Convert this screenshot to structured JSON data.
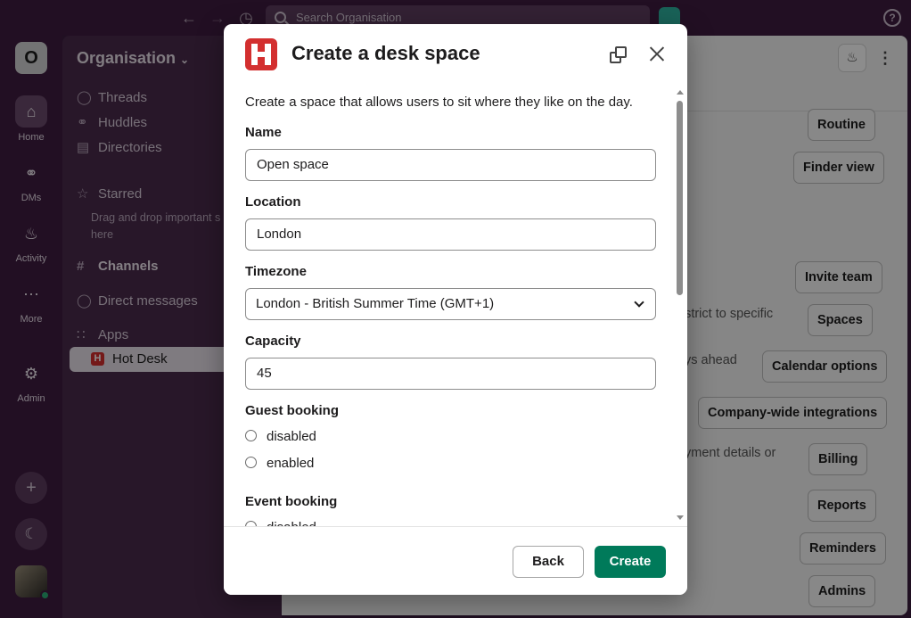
{
  "topbar": {
    "search_placeholder": "Search Organisation",
    "back_icon": "arrow-left-icon",
    "forward_icon": "arrow-right-icon",
    "history_icon": "clock-icon",
    "help_label": "?"
  },
  "rail": {
    "workspace_initial": "O",
    "items": [
      {
        "label": "Home",
        "icon": "home-icon"
      },
      {
        "label": "DMs",
        "icon": "dm-bubbles-icon"
      },
      {
        "label": "Activity",
        "icon": "bell-icon"
      },
      {
        "label": "More",
        "icon": "more-dots-icon"
      },
      {
        "label": "Admin",
        "icon": "gear-icon"
      }
    ],
    "add_label": "+",
    "theme_icon": "moon-icon"
  },
  "sidebar": {
    "org_name": "Organisation",
    "items": [
      {
        "label": "Threads",
        "icon": "threads-icon"
      },
      {
        "label": "Huddles",
        "icon": "headphones-icon"
      },
      {
        "label": "Directories",
        "icon": "directory-icon"
      },
      {
        "label": "Starred",
        "icon": "star-icon"
      },
      {
        "label": "Channels",
        "icon": "channel-icon"
      },
      {
        "label": "Direct messages",
        "icon": "dm-icon"
      },
      {
        "label": "Apps",
        "icon": "apps-grid-icon"
      }
    ],
    "starred_note": "Drag and drop important s here",
    "selected_app": "Hot Desk"
  },
  "main": {
    "buttons": [
      "Routine",
      "Finder view",
      "Invite team",
      "Spaces",
      "Calendar options",
      "Company-wide integrations",
      "Billing",
      "Reports",
      "Reminders",
      "Admins"
    ],
    "texts": [
      ".",
      "estrict to specific",
      "ys ahead",
      "yment details or"
    ]
  },
  "modal": {
    "title": "Create a desk space",
    "description": "Create a space that allows users to sit where they like on the day.",
    "fields": {
      "name_label": "Name",
      "name_value": "Open space",
      "location_label": "Location",
      "location_value": "London",
      "timezone_label": "Timezone",
      "timezone_value": "London - British Summer Time (GMT+1)",
      "capacity_label": "Capacity",
      "capacity_value": "45"
    },
    "guest_booking": {
      "label": "Guest booking",
      "options": [
        "disabled",
        "enabled"
      ]
    },
    "event_booking": {
      "label": "Event booking",
      "options": [
        "disabled"
      ]
    },
    "back_label": "Back",
    "create_label": "Create"
  },
  "colors": {
    "primary_button": "#007a5a",
    "brand_red": "#d32f2f",
    "sidebar_bg": "#4a2a4c"
  }
}
